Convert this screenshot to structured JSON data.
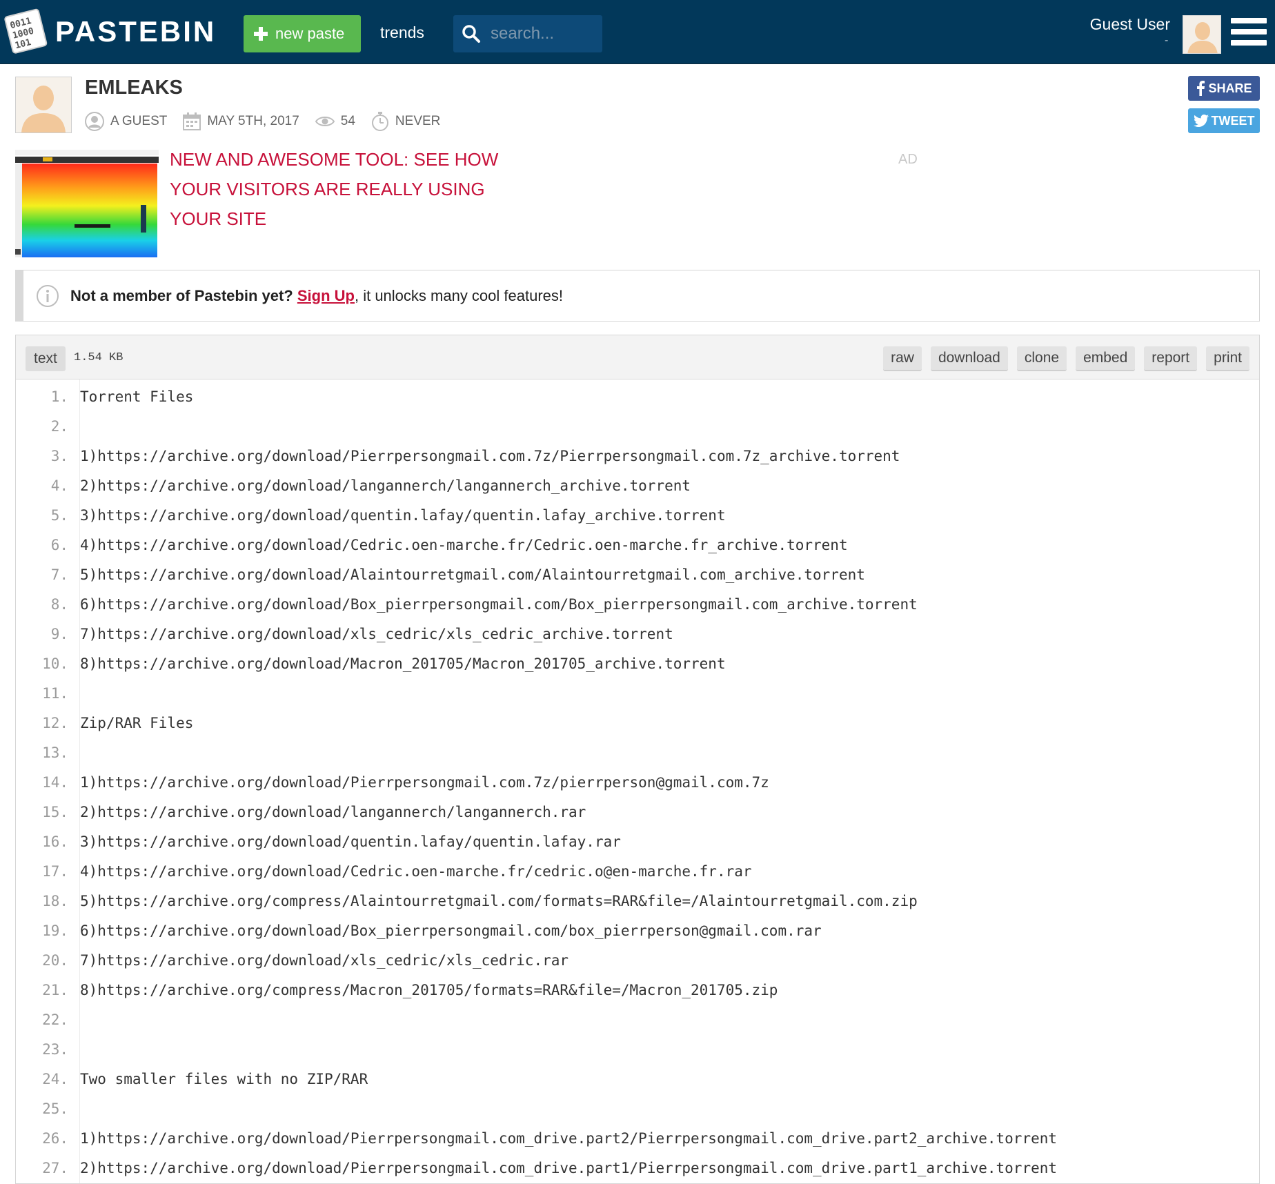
{
  "header": {
    "logo_text": "PASTEBIN",
    "new_paste_label": "new paste",
    "trends_label": "trends",
    "search_placeholder": "search...",
    "user_name": "Guest User",
    "user_sub": "-"
  },
  "paste": {
    "title": "EMLEAKS",
    "author": "A GUEST",
    "date": "MAY 5TH, 2017",
    "views": "54",
    "expiration": "NEVER",
    "share_label": "SHARE",
    "tweet_label": "TWEET"
  },
  "ad": {
    "line1": "NEW AND AWESOME TOOL: SEE HOW",
    "line2": "YOUR VISITORS ARE REALLY USING",
    "line3": "YOUR SITE",
    "tag": "AD"
  },
  "notice": {
    "question": "Not a member of Pastebin yet?",
    "signup": "Sign Up",
    "rest": ", it unlocks many cool features!"
  },
  "code_header": {
    "syntax": "text",
    "size": "1.54 KB",
    "buttons": [
      "raw",
      "download",
      "clone",
      "embed",
      "report",
      "print"
    ]
  },
  "lines": [
    "Torrent Files",
    "",
    "1)https://archive.org/download/Pierrpersongmail.com.7z/Pierrpersongmail.com.7z_archive.torrent",
    "2)https://archive.org/download/langannerch/langannerch_archive.torrent",
    "3)https://archive.org/download/quentin.lafay/quentin.lafay_archive.torrent",
    "4)https://archive.org/download/Cedric.oen-marche.fr/Cedric.oen-marche.fr_archive.torrent",
    "5)https://archive.org/download/Alaintourretgmail.com/Alaintourretgmail.com_archive.torrent",
    "6)https://archive.org/download/Box_pierrpersongmail.com/Box_pierrpersongmail.com_archive.torrent",
    "7)https://archive.org/download/xls_cedric/xls_cedric_archive.torrent",
    "8)https://archive.org/download/Macron_201705/Macron_201705_archive.torrent",
    "",
    "Zip/RAR Files",
    "",
    "1)https://archive.org/download/Pierrpersongmail.com.7z/pierrperson@gmail.com.7z",
    "2)https://archive.org/download/langannerch/langannerch.rar",
    "3)https://archive.org/download/quentin.lafay/quentin.lafay.rar",
    "4)https://archive.org/download/Cedric.oen-marche.fr/cedric.o@en-marche.fr.rar",
    "5)https://archive.org/compress/Alaintourretgmail.com/formats=RAR&file=/Alaintourretgmail.com.zip",
    "6)https://archive.org/download/Box_pierrpersongmail.com/box_pierrperson@gmail.com.rar",
    "7)https://archive.org/download/xls_cedric/xls_cedric.rar",
    "8)https://archive.org/compress/Macron_201705/formats=RAR&file=/Macron_201705.zip",
    "",
    "",
    "Two smaller files with no ZIP/RAR",
    "",
    "1)https://archive.org/download/Pierrpersongmail.com_drive.part2/Pierrpersongmail.com_drive.part2_archive.torrent",
    "2)https://archive.org/download/Pierrpersongmail.com_drive.part1/Pierrpersongmail.com_drive.part1_archive.torrent"
  ],
  "colors": {
    "header_bg": "#02385a",
    "new_paste_green": "#59b84f",
    "accent_red": "#c7113a",
    "facebook_blue": "#3b5998",
    "twitter_blue": "#4aa5e0"
  },
  "icons": {
    "logo": "binary-document-icon",
    "new_paste": "plus-icon",
    "search": "search-icon",
    "menu": "hamburger-menu-icon",
    "author": "user-circle-icon",
    "date": "calendar-icon",
    "views": "eye-icon",
    "expiration": "stopwatch-icon",
    "notice": "info-icon"
  }
}
